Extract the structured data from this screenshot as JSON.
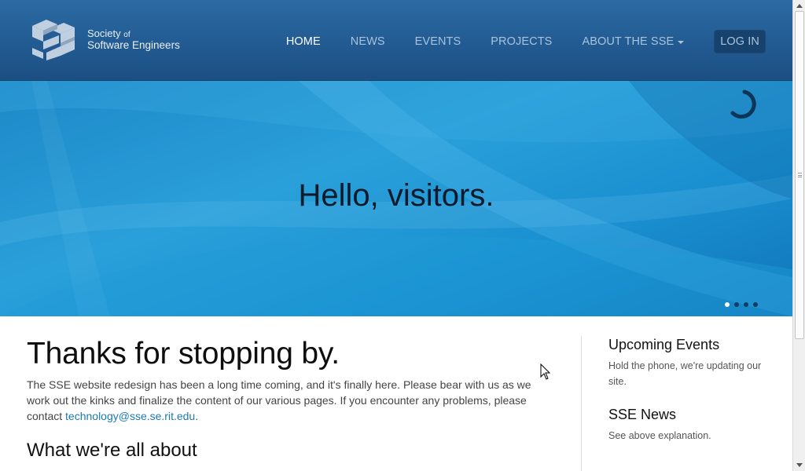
{
  "brand": {
    "line1": "Society",
    "line1_small": "of",
    "line2": "Software Engineers",
    "logo_letters": "SSE"
  },
  "nav": {
    "items": [
      "HOME",
      "NEWS",
      "EVENTS",
      "PROJECTS",
      "ABOUT THE SSE"
    ],
    "active": "HOME",
    "login_label": "LOG IN"
  },
  "hero": {
    "title": "Hello, visitors.",
    "slides_total": 4,
    "active_slide": 1
  },
  "main": {
    "heading": "Thanks for stopping by.",
    "intro_text": "The SSE website redesign has been a long time coming, and it's finally here. Please bear with us as we work out the kinks and finalize the content of our various pages. If you encounter any problems, please contact ",
    "contact_email": "technology@sse.se.rit.edu",
    "intro_end": ".",
    "subheading": "What we're all about"
  },
  "sidebar": {
    "events_title": "Upcoming Events",
    "events_text": "Hold the phone, we're updating our site.",
    "news_title": "SSE News",
    "news_text": "See above explanation."
  },
  "colors": {
    "header": "#225b92",
    "hero": "#2aa0da",
    "link": "#1b7ab3",
    "login_bg": "#17426d"
  },
  "icons": [
    "sse-logo-icon",
    "loading-spinner-icon",
    "caret-down-icon",
    "mouse-cursor-icon"
  ]
}
